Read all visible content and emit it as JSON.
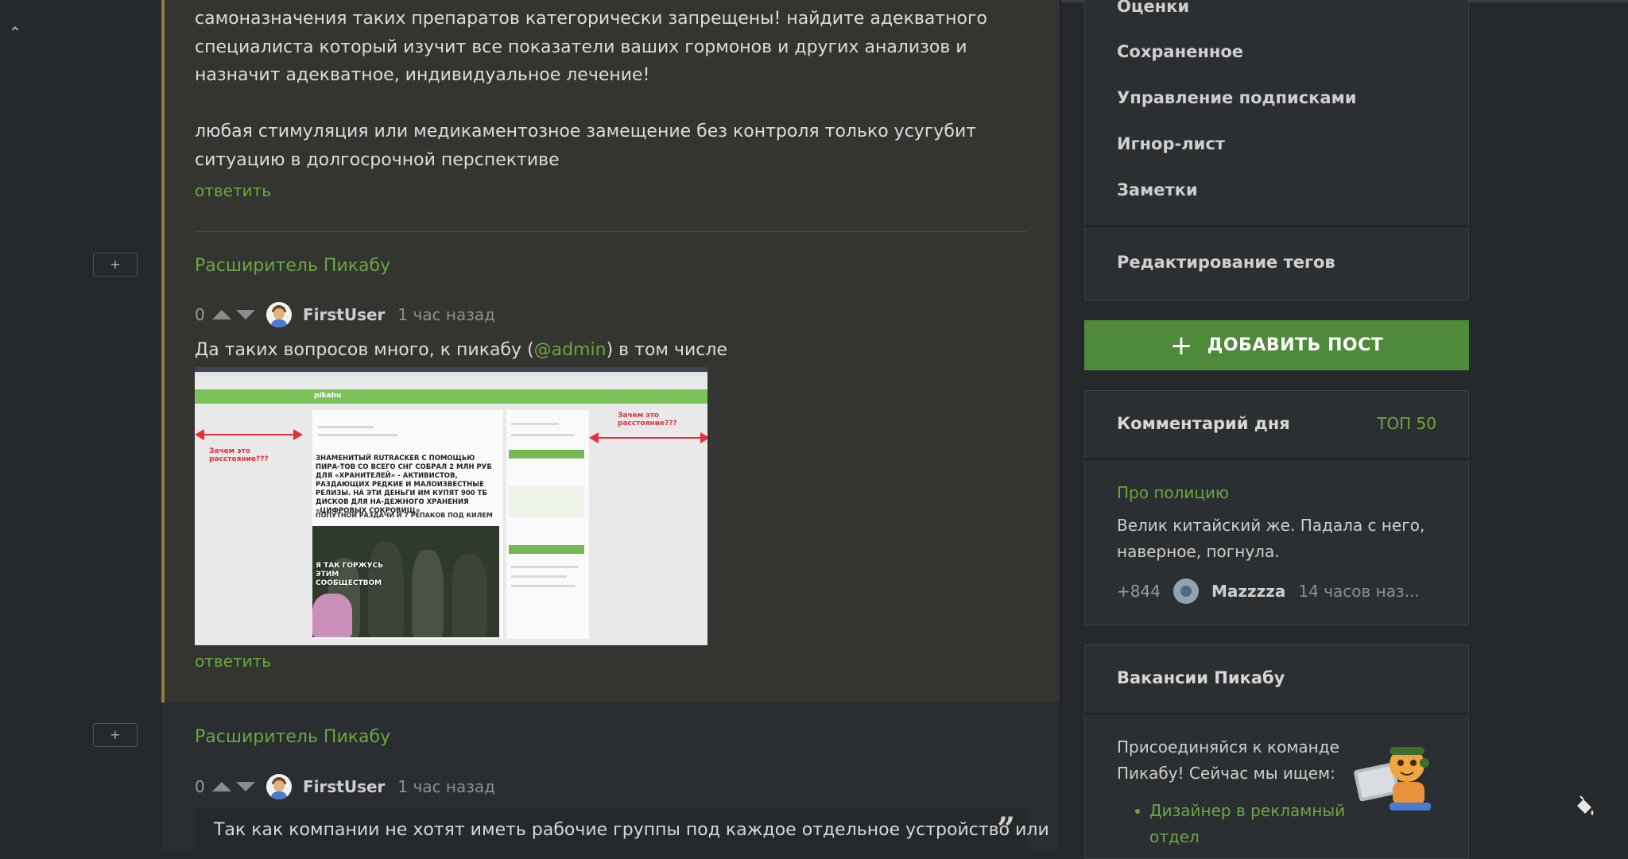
{
  "thread": {
    "top_text_1": "самоназначения таких препаратов категорически запрещены! найдите адекватного специалиста который изучит все показатели ваших гормонов и других анализов и назначит адекватное, индивидуальное лечение!",
    "top_text_2": "любая стимуляция или медикаментозное замещение без контроля только усугубит ситуацию в долгосрочной перспективе",
    "reply_label": "ответить",
    "expand_label": "+"
  },
  "comments": [
    {
      "extension_title": "Расширитель Пикабу",
      "rating": "0",
      "user": "FirstUser",
      "time": "1 час назад",
      "text_before": "Да таких вопросов много, к пикабу (",
      "mention": "@admin",
      "text_after": ") в том числе",
      "reply_label": "ответить"
    },
    {
      "extension_title": "Расширитель Пикабу",
      "rating": "0",
      "user": "FirstUser",
      "time": "1 час назад",
      "quote_text": "Так как компании не хотят иметь рабочие группы под каждое отдельное устройство или"
    }
  ],
  "embedded_screenshot": {
    "logo": "pikabu",
    "note_left": "Зачем это расстояние???",
    "note_right": "Зачем это расстояние???",
    "caption": "ЗНАМЕНИТЫЙ RUTRACKER С ПОМОЩЬЮ ПИРА-ТОВ СО ВСЕГО СНГ СОБРАЛ 2 МЛН РУБ ДЛЯ «ХРАНИТЕЛЕЙ» - АКТИВИСТОВ, РАЗДАЮЩИХ РЕДКИЕ И МАЛОИЗВЕСТНЫЕ РЕЛИЗЫ. НА ЭТИ ДЕНЬГИ ИМ КУПЯТ 900 ТБ ДИСКОВ ДЛЯ НА-ДЕЖНОГО ХРАНЕНИЯ «ЦИФРОВЫХ СОКРОВИЩ»",
    "caption2": "ПОПУТНОЙ РАЗДАЧИ И 7 РЕПАКОВ ПОД КИЛЕМ",
    "image_text": "Я ТАК ГОРЖУСЬ ЭТИМ СООБЩЕСТВОМ"
  },
  "sidebar": {
    "menu": [
      "Оценки",
      "Сохраненное",
      "Управление подписками",
      "Игнор-лист",
      "Заметки"
    ],
    "edit_tags": "Редактирование тегов",
    "add_post": "ДОБАВИТЬ ПОСТ",
    "comment_of_day": {
      "title": "Комментарий дня",
      "top_link": "ТОП 50",
      "post_title": "Про полицию",
      "text": "Велик китайский же. Падала с него, наверное, погнула.",
      "rating": "+844",
      "user": "Mazzzza",
      "time": "14 часов наз..."
    },
    "vacancies": {
      "title": "Вакансии Пикабу",
      "text": "Присоединяйся к команде Пикабу! Сейчас мы ищем:",
      "link": "Дизайнер в рекламный отдел"
    }
  },
  "colors": {
    "accent_green": "#6aa83f",
    "add_post_bg": "#4f8a3a",
    "thread_line": "#8b8335"
  },
  "icons": [
    "chevron-up-icon",
    "arrow-up-icon",
    "arrow-down-icon",
    "plus-icon",
    "quote-icon",
    "paint-bucket-icon"
  ]
}
